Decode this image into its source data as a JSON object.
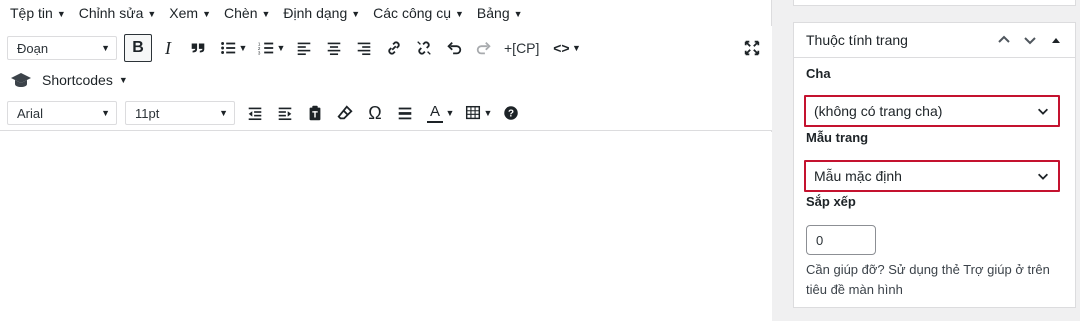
{
  "menubar": {
    "items": [
      "Tệp tin",
      "Chỉnh sửa",
      "Xem",
      "Chèn",
      "Định dạng",
      "Các công cụ",
      "Bảng"
    ]
  },
  "toolbar": {
    "block_format": "Đoạn",
    "bold_label": "B",
    "italic_label": "I",
    "cp_label": "+[CP]",
    "code_label": "<>",
    "shortcodes_label": "Shortcodes",
    "font_family": "Arial",
    "font_size": "11pt",
    "omega_label": "Ω",
    "text_color_label": "A"
  },
  "panel": {
    "title": "Thuộc tính trang",
    "parent_label": "Cha",
    "parent_value": "(không có trang cha)",
    "template_label": "Mẫu trang",
    "template_value": "Mẫu mặc định",
    "order_label": "Sắp xếp",
    "order_value": "0",
    "help_text": "Cần giúp đỡ? Sử dụng thẻ Trợ giúp ở trên tiêu đề màn hình"
  },
  "colors": {
    "highlight_border": "#c4122f",
    "border": "#dcdcde",
    "background": "#f0f0f1"
  }
}
